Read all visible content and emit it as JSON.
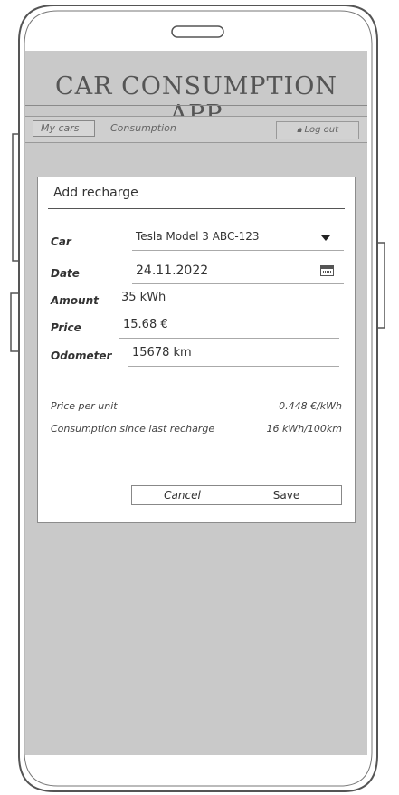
{
  "app": {
    "title": "CAR CONSUMPTION APP"
  },
  "nav": {
    "tabs": [
      {
        "label": "My cars",
        "active": true
      },
      {
        "label": "Consumption",
        "active": false
      }
    ],
    "logout_icon": "lock-icon",
    "logout_label": "Log out"
  },
  "form": {
    "title": "Add recharge",
    "fields": {
      "car": {
        "label": "Car",
        "value": "Tesla Model 3 ABC-123",
        "icon": "chevron-down-icon"
      },
      "date": {
        "label": "Date",
        "value": "24.11.2022",
        "icon": "calendar-icon"
      },
      "amount": {
        "label": "Amount",
        "value": "35 kWh"
      },
      "price": {
        "label": "Price",
        "value": "15.68 €"
      },
      "odometer": {
        "label": "Odometer",
        "value": "15678 km"
      }
    },
    "stats": {
      "price_per_unit": {
        "label": "Price per unit",
        "value": "0.448 €/kWh"
      },
      "consumption": {
        "label": "Consumption since last recharge",
        "value": "16 kWh/100km"
      }
    },
    "buttons": {
      "cancel": "Cancel",
      "save": "Save"
    }
  }
}
